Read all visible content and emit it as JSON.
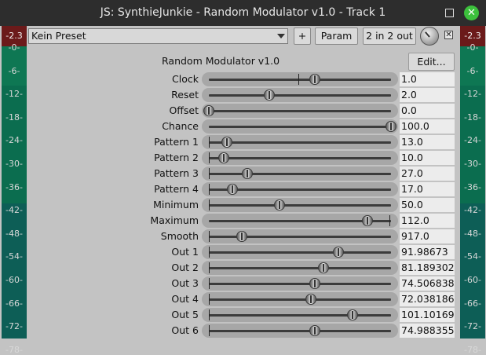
{
  "window": {
    "title": "JS: SynthieJunkie - Random Modulator v1.0 - Track 1",
    "close_glyph": "✕"
  },
  "toolbar": {
    "preset": "Kein Preset",
    "plus_label": "+",
    "param_label": "Param",
    "io_label": "2 in 2 out",
    "bypass_glyph": "✕"
  },
  "plugin": {
    "title": "Random Modulator v1.0",
    "edit_label": "Edit..."
  },
  "meters": {
    "left_peak": "-2.3",
    "right_peak": "-2.3",
    "scale": [
      "-0-",
      "-6-",
      "-12-",
      "-18-",
      "-24-",
      "-30-",
      "-36-",
      "-42-",
      "-48-",
      "-54-",
      "-60-",
      "-66-",
      "-72-",
      "-78-"
    ]
  },
  "sliders": [
    {
      "label": "Clock",
      "value": "1.0",
      "level": 0.58,
      "default": 0.49
    },
    {
      "label": "Reset",
      "value": "2.0",
      "level": 0.33,
      "default": null
    },
    {
      "label": "Offset",
      "value": "0.0",
      "level": 0.0,
      "default": 0.0
    },
    {
      "label": "Chance",
      "value": "100.0",
      "level": 1.0,
      "default": 1.0
    },
    {
      "label": "Pattern 1",
      "value": "13.0",
      "level": 0.1,
      "default": 0.0
    },
    {
      "label": "Pattern 2",
      "value": "10.0",
      "level": 0.08,
      "default": 0.0
    },
    {
      "label": "Pattern 3",
      "value": "27.0",
      "level": 0.21,
      "default": 0.0
    },
    {
      "label": "Pattern 4",
      "value": "17.0",
      "level": 0.13,
      "default": 0.0
    },
    {
      "label": "Minimum",
      "value": "50.0",
      "level": 0.39,
      "default": 0.0
    },
    {
      "label": "Maximum",
      "value": "112.0",
      "level": 0.87,
      "default": 0.99
    },
    {
      "label": "Smooth",
      "value": "917.0",
      "level": 0.18,
      "default": 0.0
    },
    {
      "label": "Out 1",
      "value": "91.98673",
      "level": 0.71,
      "default": 0.0
    },
    {
      "label": "Out 2",
      "value": "81.189302",
      "level": 0.63,
      "default": 0.0
    },
    {
      "label": "Out 3",
      "value": "74.506838",
      "level": 0.58,
      "default": 0.0
    },
    {
      "label": "Out 4",
      "value": "72.038186",
      "level": 0.56,
      "default": 0.0
    },
    {
      "label": "Out 5",
      "value": "101.101693",
      "level": 0.79,
      "default": 0.0
    },
    {
      "label": "Out 6",
      "value": "74.988355",
      "level": 0.58,
      "default": 0.0
    }
  ],
  "colors": {
    "meter_green": "#0b6a4f",
    "meter_peak_red": "#6b1a1a",
    "close_green": "#3cc13c"
  }
}
